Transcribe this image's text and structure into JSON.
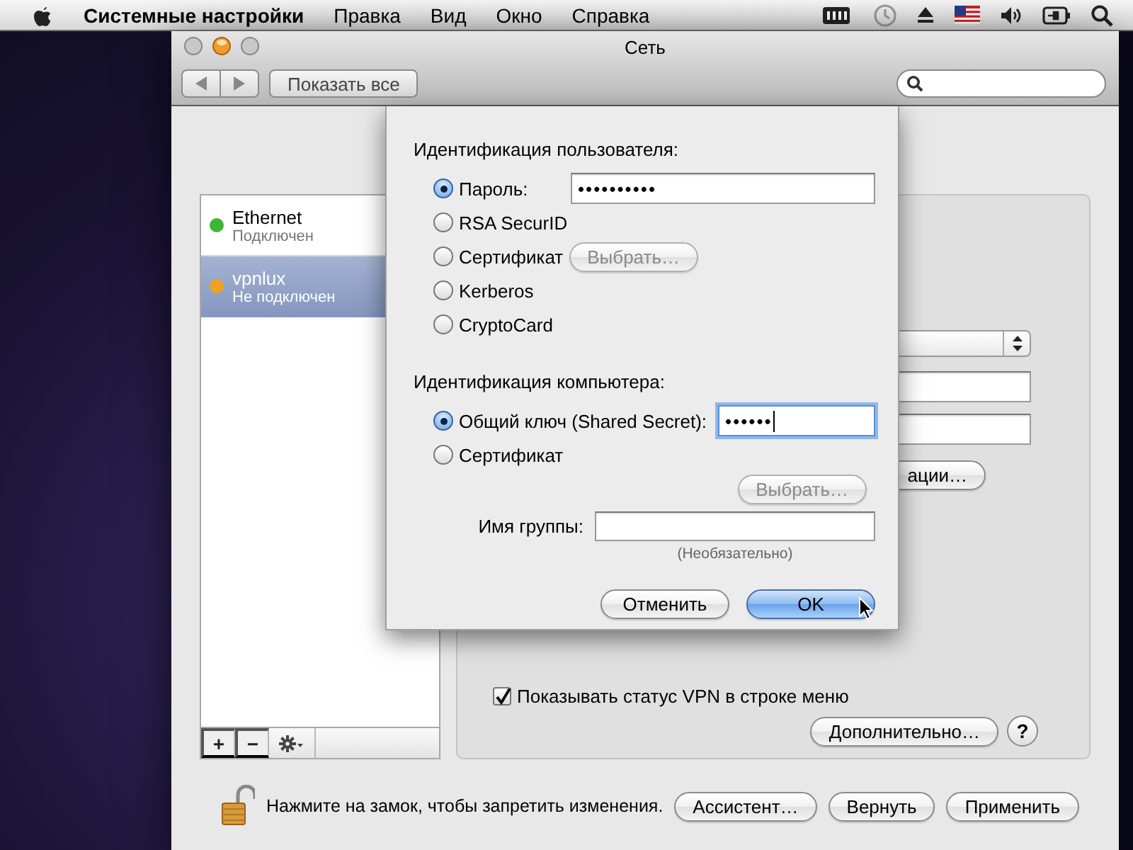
{
  "menu_bar": {
    "app": "Системные настройки",
    "menus": [
      "Правка",
      "Вид",
      "Окно",
      "Справка"
    ]
  },
  "window": {
    "title": "Сеть",
    "show_all": "Показать все"
  },
  "services": [
    {
      "name": "Ethernet",
      "status": "Подключен",
      "color": "#3db535",
      "selected": false
    },
    {
      "name": "vpnlux",
      "status": "Не подключен",
      "color": "#f2a022",
      "selected": true
    }
  ],
  "list_tools": [
    "+",
    "−"
  ],
  "vpn_panel": {
    "auth_button_fragment": "ации…",
    "show_status": {
      "label": "Показывать статус VPN в строке меню",
      "checked": true
    },
    "advanced": "Дополнительно…",
    "help": "?"
  },
  "sheet": {
    "user_auth": {
      "heading": "Идентификация пользователя:",
      "options": [
        {
          "label": "Пароль:",
          "selected": true,
          "kind": "field",
          "value": "••••••••••"
        },
        {
          "label": "RSA SecurID",
          "selected": false,
          "kind": "plain"
        },
        {
          "label": "Сертификат",
          "selected": false,
          "kind": "button",
          "button": {
            "label": "Выбрать…",
            "disabled": true
          }
        },
        {
          "label": "Kerberos",
          "selected": false,
          "kind": "plain"
        },
        {
          "label": "CryptoCard",
          "selected": false,
          "kind": "plain"
        }
      ]
    },
    "machine_auth": {
      "heading": "Идентификация компьютера:",
      "options": [
        {
          "label": "Общий ключ (Shared Secret):",
          "selected": true,
          "kind": "field",
          "value": "••••••"
        },
        {
          "label": "Сертификат",
          "selected": false,
          "kind": "plain"
        }
      ],
      "choose_button": {
        "label": "Выбрать…",
        "disabled": true
      },
      "group_name": {
        "label": "Имя группы:",
        "hint": "(Необязательно)"
      }
    },
    "buttons": [
      {
        "label": "Отменить",
        "default": false
      },
      {
        "label": "OK",
        "default": true
      }
    ]
  },
  "footer": {
    "lock_text": "Нажмите на замок, чтобы запретить изменения.",
    "buttons": [
      "Ассистент…",
      "Вернуть",
      "Применить"
    ]
  }
}
